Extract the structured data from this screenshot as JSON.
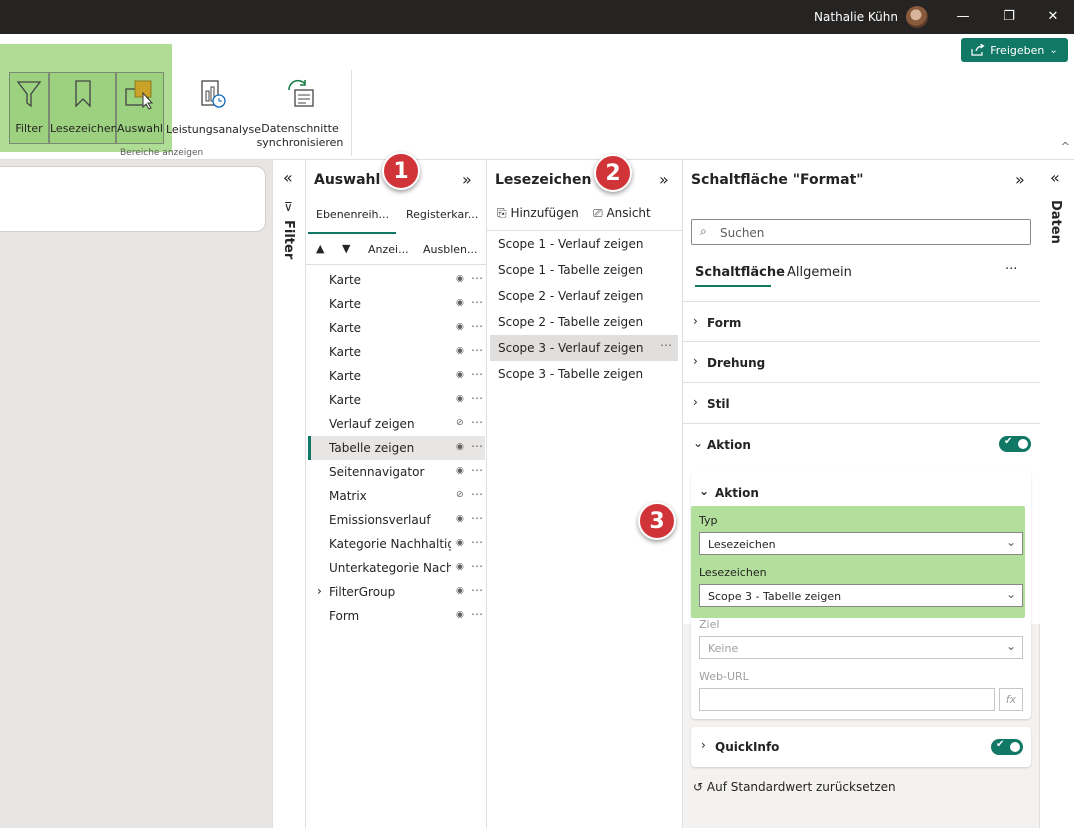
{
  "titlebar": {
    "user": "Nathalie Kühn",
    "minimize": "—",
    "maximize": "❐",
    "close": "✕"
  },
  "ribbon": {
    "share_label": "Freigeben",
    "buttons": [
      {
        "label": "Filter",
        "icon": "filter-icon"
      },
      {
        "label": "Lesezeichen",
        "icon": "bookmark-icon"
      },
      {
        "label": "Auswahl",
        "icon": "selection-icon"
      },
      {
        "label": "Leistungsanalyse",
        "icon": "performance-icon"
      },
      {
        "label": "Datenschnitte synchronisieren",
        "icon": "sync-slicers-icon"
      }
    ],
    "group_label": "Bereiche anzeigen",
    "collapse": "^"
  },
  "filter_strip": {
    "label": "Filter",
    "expand": "«"
  },
  "selection_pane": {
    "title": "Auswahl",
    "collapse": "»",
    "tabs": [
      "Ebenenreih...",
      "Registerkar..."
    ],
    "toolbar": {
      "show": "Anzei...",
      "hide": "Ausblen..."
    },
    "items": [
      {
        "name": "Karte",
        "visible": true
      },
      {
        "name": "Karte",
        "visible": true
      },
      {
        "name": "Karte",
        "visible": true
      },
      {
        "name": "Karte",
        "visible": true
      },
      {
        "name": "Karte",
        "visible": true
      },
      {
        "name": "Karte",
        "visible": true
      },
      {
        "name": "Verlauf zeigen",
        "visible": false
      },
      {
        "name": "Tabelle zeigen",
        "visible": true,
        "selected": true
      },
      {
        "name": "Seitennavigator",
        "visible": true
      },
      {
        "name": "Matrix",
        "visible": false
      },
      {
        "name": "Emissionsverlauf",
        "visible": true
      },
      {
        "name": "Kategorie Nachhaltig...",
        "visible": true
      },
      {
        "name": "Unterkategorie Nach...",
        "visible": true
      },
      {
        "name": "FilterGroup",
        "visible": true,
        "group": true
      },
      {
        "name": "Form",
        "visible": true
      }
    ]
  },
  "bookmarks_pane": {
    "title": "Lesezeichen",
    "collapse": "»",
    "add": "Hinzufügen",
    "view": "Ansicht",
    "items": [
      "Scope 1 - Verlauf zeigen",
      "Scope 1 - Tabelle zeigen",
      "Scope 2 - Verlauf zeigen",
      "Scope 2 - Tabelle zeigen",
      "Scope 3 - Verlauf zeigen",
      "Scope 3 - Tabelle zeigen"
    ],
    "selected_index": 4
  },
  "format_pane": {
    "title": "Schaltfläche \"Format\"",
    "collapse": "»",
    "search_placeholder": "Suchen",
    "tabs": [
      "Schaltfläche",
      "Allgemein"
    ],
    "more": "···",
    "sections": [
      "Form",
      "Drehung",
      "Stil",
      "Aktion"
    ],
    "aktion_card": {
      "title": "Aktion",
      "typ_label": "Typ",
      "typ_value": "Lesezeichen",
      "bookmark_label": "Lesezeichen",
      "bookmark_value": "Scope 3 - Tabelle zeigen",
      "ziel_label": "Ziel",
      "ziel_value": "Keine",
      "weburl_label": "Web-URL",
      "fx": "fx"
    },
    "quickinfo": "QuickInfo",
    "reset": "Auf Standardwert zurücksetzen"
  },
  "daten_strip": {
    "label": "Daten",
    "expand": "«"
  },
  "badges": [
    "1",
    "2",
    "3"
  ],
  "colors": {
    "accent": "#117865",
    "highlight": "#a6d98b",
    "badge": "#d13438"
  }
}
